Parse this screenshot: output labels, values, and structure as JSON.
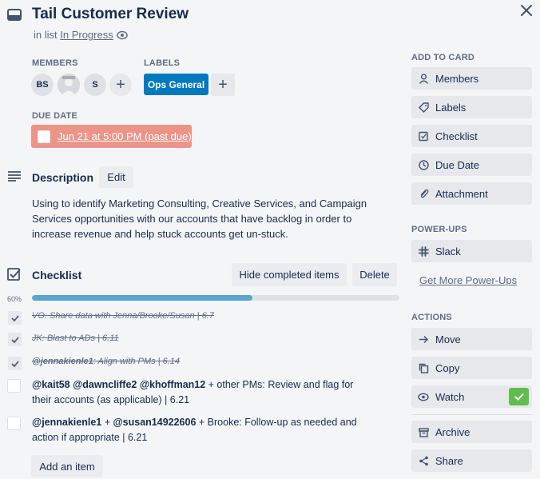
{
  "card": {
    "title": "Tail Customer Review",
    "in_list_prefix": "in list",
    "list_name": "In Progress"
  },
  "members": {
    "label": "MEMBERS",
    "avatars": [
      "BS",
      "",
      "S"
    ],
    "add": "+"
  },
  "labels": {
    "label": "LABELS",
    "chips": [
      {
        "name": "Ops General",
        "color": "#0079bf"
      }
    ],
    "add": "+"
  },
  "due": {
    "label": "DUE DATE",
    "text": "Jun 21 at 5:00 PM (past due)",
    "color": "#ec9488"
  },
  "description": {
    "heading": "Description",
    "edit": "Edit",
    "text": "Using to identify Marketing Consulting, Creative Services, and Campaign Services opportunities with our accounts that have backlog in order to increase revenue and help stuck accounts get un-stuck."
  },
  "checklist": {
    "heading": "Checklist",
    "hide_completed": "Hide completed items",
    "delete": "Delete",
    "progress_text": "60%",
    "progress": 0.6,
    "add_item": "Add an item",
    "items": [
      {
        "done": true,
        "text": "VO: Share data with Jenna/Brooke/Susan | 6.7"
      },
      {
        "done": true,
        "text": "JK: Blast to ADs | 6.11"
      },
      {
        "done": true,
        "mention": "@jennakienle1",
        "text": ": Align with PMs | 6.14"
      },
      {
        "done": false,
        "mentions": "@kait58 @dawncliffe2 @khoffman12",
        "text_line1": " + other PMs: Review and flag for",
        "text_line2": "their accounts (as applicable) | 6.21"
      },
      {
        "done": false,
        "mentions": "@jennakienle1",
        "mid": " + ",
        "mention2": "@susan14922606",
        "text_line1": " + Brooke: Follow-up as needed and",
        "text_line2": "action if appropriate | 6.21"
      }
    ]
  },
  "sidebar": {
    "add_to_card": {
      "label": "ADD TO CARD",
      "buttons": [
        {
          "label": "Members",
          "icon": "person-icon"
        },
        {
          "label": "Labels",
          "icon": "tag-icon"
        },
        {
          "label": "Checklist",
          "icon": "checklist-icon"
        },
        {
          "label": "Due Date",
          "icon": "clock-icon"
        },
        {
          "label": "Attachment",
          "icon": "paperclip-icon"
        }
      ]
    },
    "power_ups": {
      "label": "POWER-UPS",
      "slack": "Slack",
      "get_more": "Get More Power-Ups"
    },
    "actions": {
      "label": "ACTIONS",
      "buttons": [
        {
          "label": "Move",
          "icon": "arrow-right-icon"
        },
        {
          "label": "Copy",
          "icon": "copy-icon"
        },
        {
          "label": "Watch",
          "icon": "eye-icon",
          "checked": true
        },
        {
          "label": "Archive",
          "icon": "archive-icon"
        },
        {
          "label": "Share",
          "icon": "share-icon"
        }
      ]
    },
    "accent_green": "#61bd4f"
  }
}
